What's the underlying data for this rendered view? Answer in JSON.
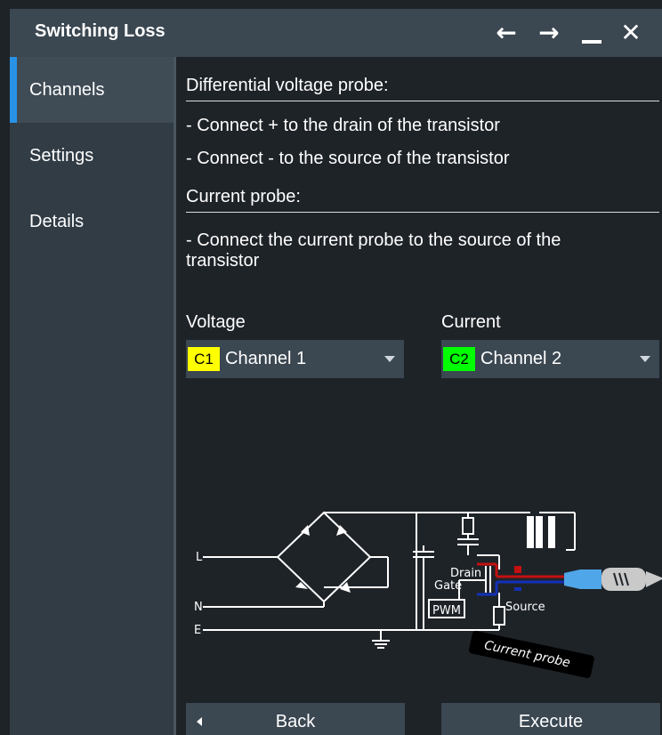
{
  "window": {
    "title": "Switching Loss",
    "controls": {
      "back": "←",
      "forward": "→",
      "minimize": "▁",
      "close": "✕"
    }
  },
  "sidebar": {
    "items": [
      {
        "label": "Channels",
        "active": true
      },
      {
        "label": "Settings",
        "active": false
      },
      {
        "label": "Details",
        "active": false
      }
    ],
    "accent_color": "#2893e6"
  },
  "content": {
    "diff_probe_heading": "Differential voltage probe:",
    "diff_probe_line1": "- Connect + to the drain of the transistor",
    "diff_probe_line2": "- Connect - to the source of the transistor",
    "current_probe_heading": "Current probe:",
    "current_probe_line1": "- Connect the current probe to the source of the",
    "current_probe_line2": "transistor",
    "voltage": {
      "label": "Voltage",
      "chip": "C1",
      "chip_color": "#ffff00",
      "value": "Channel 1"
    },
    "current": {
      "label": "Current",
      "chip": "C2",
      "chip_color": "#00ff00",
      "value": "Channel 2"
    }
  },
  "diagram": {
    "labels": {
      "L": "L",
      "N": "N",
      "E": "E",
      "drain": "Drain",
      "gate": "Gate",
      "pwm": "PWM",
      "source": "Source",
      "current_probe": "Current probe"
    }
  },
  "footer": {
    "back": "Back",
    "execute": "Execute"
  }
}
